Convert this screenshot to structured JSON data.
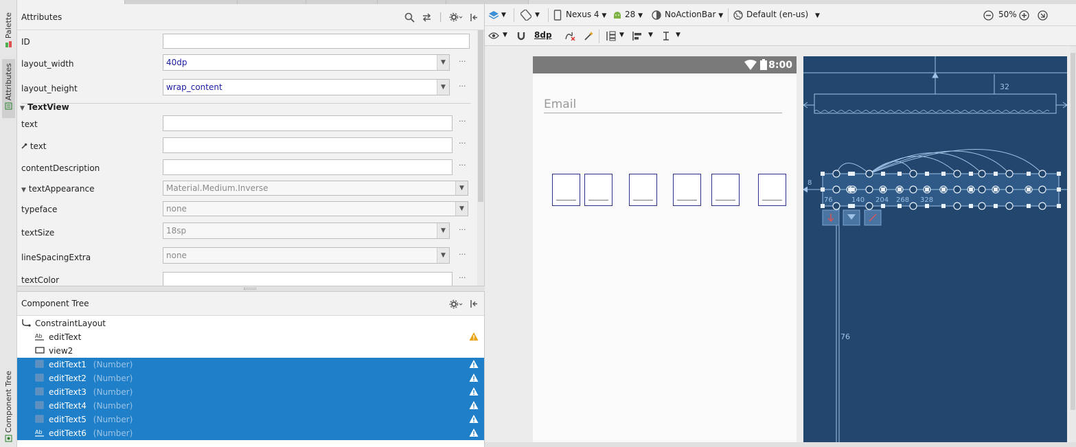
{
  "side_tabs": {
    "palette": "Palette",
    "attributes": "Attributes",
    "component_tree": "Component Tree"
  },
  "attributes": {
    "title": "Attributes",
    "rows": {
      "id": {
        "label": "ID",
        "value": ""
      },
      "layout_width": {
        "label": "layout_width",
        "value": "40dp"
      },
      "layout_height": {
        "label": "layout_height",
        "value": "wrap_content"
      }
    },
    "section_textview": "TextView",
    "text": {
      "label": "text",
      "value": ""
    },
    "text_tools": {
      "label": "text",
      "value": ""
    },
    "content_description": {
      "label": "contentDescription",
      "value": ""
    },
    "text_appearance": {
      "label": "textAppearance",
      "value": "Material.Medium.Inverse"
    },
    "typeface": {
      "label": "typeface",
      "value": "none"
    },
    "text_size": {
      "label": "textSize",
      "value": "18sp"
    },
    "line_spacing_extra": {
      "label": "lineSpacingExtra",
      "value": "none"
    },
    "text_color": {
      "label": "textColor",
      "value": ""
    },
    "more": "···"
  },
  "component_tree": {
    "title": "Component Tree",
    "items": [
      {
        "label": "ConstraintLayout",
        "sub": "",
        "icon": "constraint-layout-icon",
        "warn": false,
        "selected": false
      },
      {
        "label": "editText",
        "sub": "",
        "icon": "ab-text-icon",
        "warn": true,
        "selected": false
      },
      {
        "label": "view2",
        "sub": "",
        "icon": "view-icon",
        "warn": false,
        "selected": false
      },
      {
        "label": "editText1",
        "sub": "(Number)",
        "icon": "number-icon",
        "warn": true,
        "selected": true
      },
      {
        "label": "editText2",
        "sub": "(Number)",
        "icon": "number-icon",
        "warn": true,
        "selected": true
      },
      {
        "label": "editText3",
        "sub": "(Number)",
        "icon": "number-icon",
        "warn": true,
        "selected": true
      },
      {
        "label": "editText4",
        "sub": "(Number)",
        "icon": "number-icon",
        "warn": true,
        "selected": true
      },
      {
        "label": "editText5",
        "sub": "(Number)",
        "icon": "number-icon",
        "warn": true,
        "selected": true
      },
      {
        "label": "editText6",
        "sub": "(Number)",
        "icon": "ab-text-icon",
        "warn": true,
        "selected": true
      }
    ]
  },
  "toolbar": {
    "device": "Nexus 4",
    "api": "28",
    "theme": "NoActionBar",
    "locale": "Default (en-us)",
    "zoom": "50%",
    "margin": "8dp"
  },
  "design": {
    "status_time": "8:00",
    "email_hint": "Email"
  },
  "blueprint": {
    "labels": {
      "top_margin": "32",
      "left_margin": "8",
      "m1": "76",
      "m2": "140",
      "m3": "204",
      "m4": "268",
      "m5": "328",
      "vertical": "76"
    }
  },
  "colors": {
    "selection": "#1f7fc8",
    "blueprint_bg": "#22466d",
    "warning": "#e8a317",
    "value_blue": "#1a1aa6"
  }
}
